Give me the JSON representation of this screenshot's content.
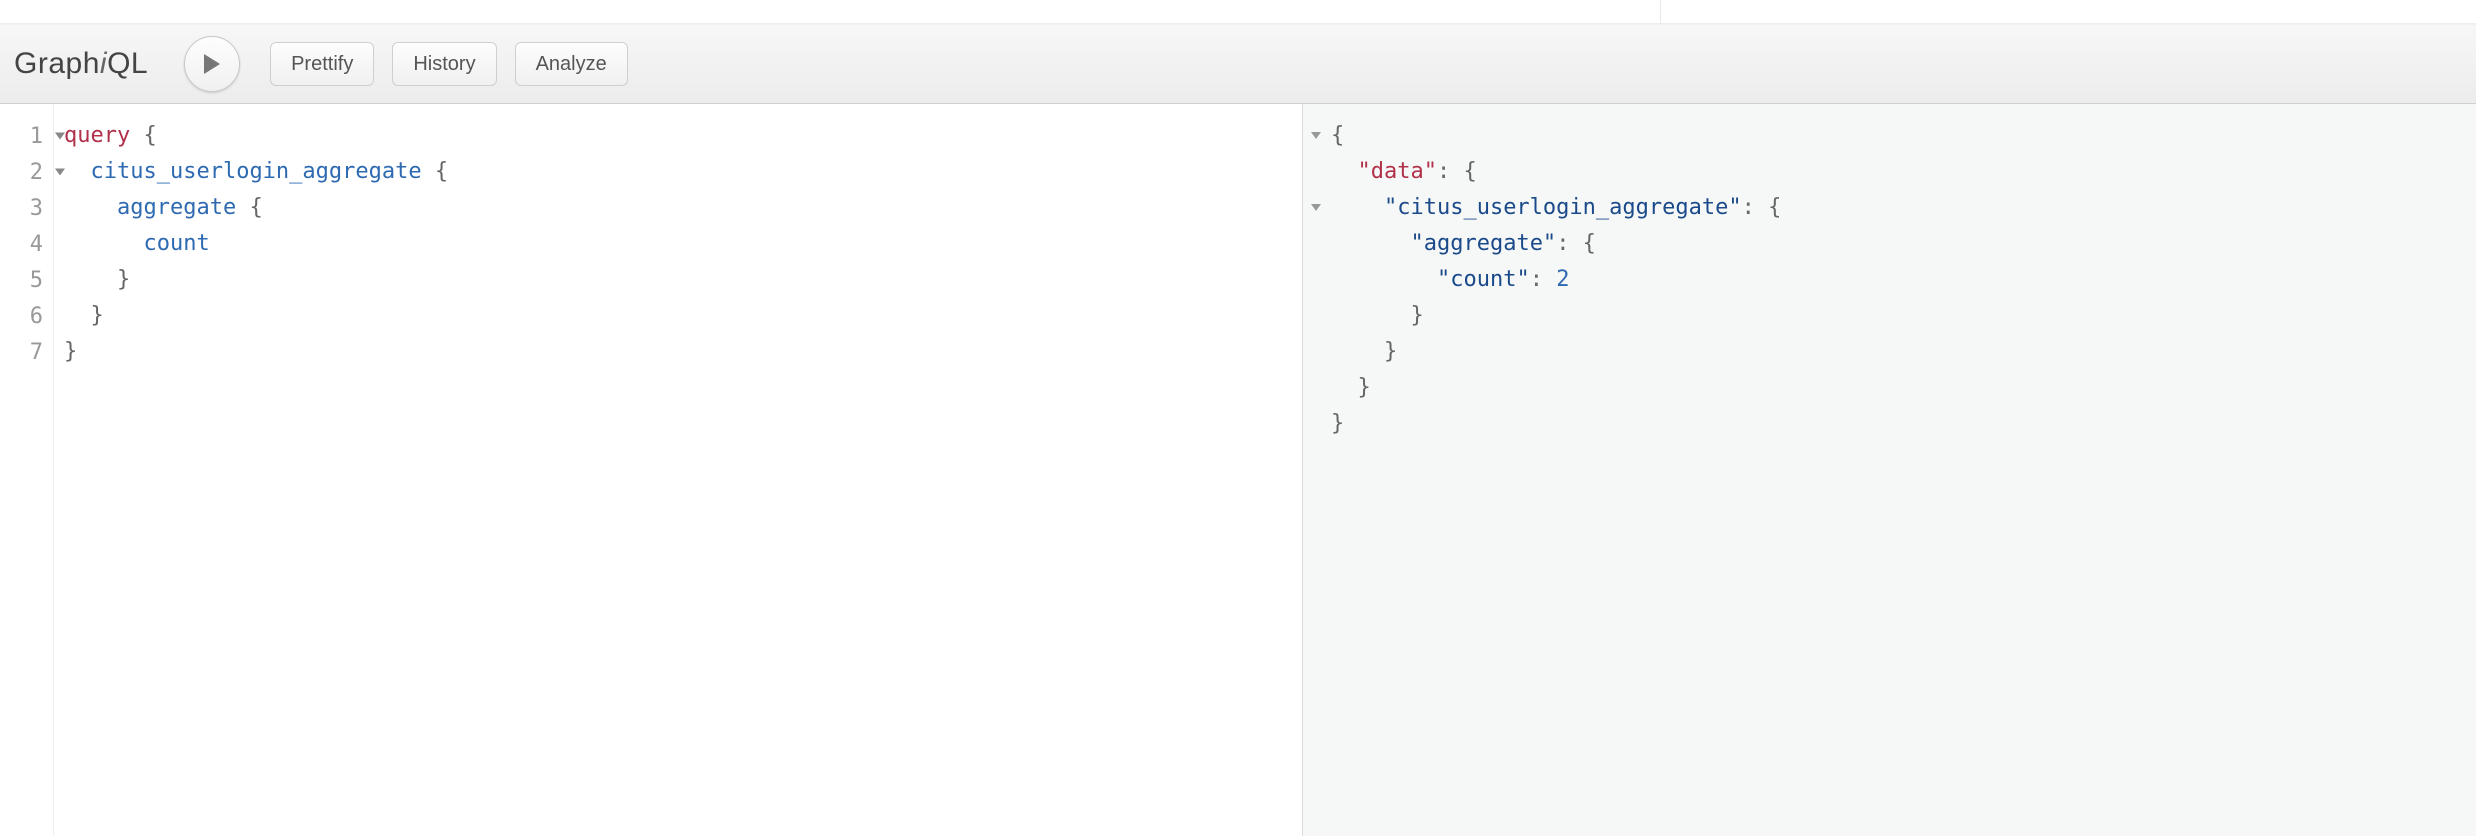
{
  "toolbar": {
    "logo_pre": "Graph",
    "logo_i": "i",
    "logo_post": "QL",
    "prettify": "Prettify",
    "history": "History",
    "analyze": "Analyze"
  },
  "editor": {
    "line_numbers": [
      "1",
      "2",
      "3",
      "4",
      "5",
      "6",
      "7"
    ],
    "fold_lines": [
      1,
      2
    ],
    "tokens": [
      [
        {
          "t": "kw",
          "v": "query"
        },
        {
          "t": "punct",
          "v": " {"
        }
      ],
      [
        {
          "t": "punct",
          "v": "  "
        },
        {
          "t": "attr",
          "v": "citus_userlogin_aggregate"
        },
        {
          "t": "punct",
          "v": " {"
        }
      ],
      [
        {
          "t": "punct",
          "v": "    "
        },
        {
          "t": "attr",
          "v": "aggregate"
        },
        {
          "t": "punct",
          "v": " {"
        }
      ],
      [
        {
          "t": "punct",
          "v": "      "
        },
        {
          "t": "attr",
          "v": "count"
        }
      ],
      [
        {
          "t": "punct",
          "v": "    }"
        }
      ],
      [
        {
          "t": "punct",
          "v": "  }"
        }
      ],
      [
        {
          "t": "punct",
          "v": "}"
        }
      ]
    ]
  },
  "result": {
    "fold_lines": [
      1,
      3
    ],
    "tokens": [
      [
        {
          "t": "punct",
          "v": "{"
        }
      ],
      [
        {
          "t": "punct",
          "v": "  "
        },
        {
          "t": "key",
          "v": "\"data\""
        },
        {
          "t": "punct",
          "v": ": {"
        }
      ],
      [
        {
          "t": "punct",
          "v": "    "
        },
        {
          "t": "str",
          "v": "\"citus_userlogin_aggregate\""
        },
        {
          "t": "punct",
          "v": ": {"
        }
      ],
      [
        {
          "t": "punct",
          "v": "      "
        },
        {
          "t": "str",
          "v": "\"aggregate\""
        },
        {
          "t": "punct",
          "v": ": {"
        }
      ],
      [
        {
          "t": "punct",
          "v": "        "
        },
        {
          "t": "str",
          "v": "\"count\""
        },
        {
          "t": "punct",
          "v": ": "
        },
        {
          "t": "num",
          "v": "2"
        }
      ],
      [
        {
          "t": "punct",
          "v": "      }"
        }
      ],
      [
        {
          "t": "punct",
          "v": "    }"
        }
      ],
      [
        {
          "t": "punct",
          "v": "  }"
        }
      ],
      [
        {
          "t": "punct",
          "v": "}"
        }
      ]
    ]
  }
}
